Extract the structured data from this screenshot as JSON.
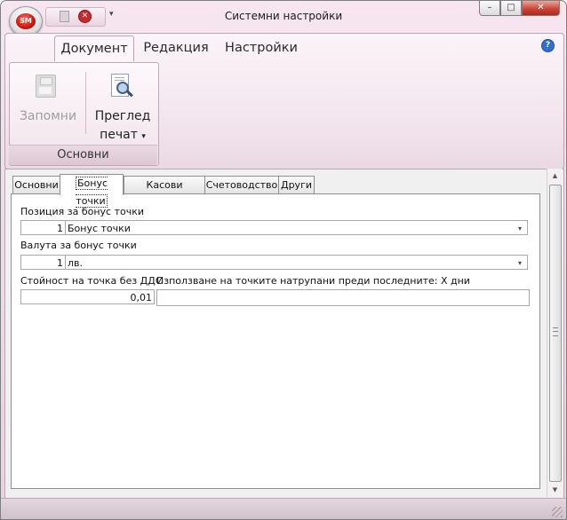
{
  "window": {
    "title": "Системни настройки",
    "controls": {
      "minimize": "–",
      "maximize": "□",
      "close": "✕"
    }
  },
  "app_orb": {
    "text": "SM"
  },
  "quick_access": {
    "close_glyph": "✕",
    "dropdown_glyph": "▾"
  },
  "ribbon": {
    "tabs": [
      {
        "label": "Документ",
        "active": true
      },
      {
        "label": "Редакция",
        "active": false
      },
      {
        "label": "Настройки",
        "active": false
      }
    ],
    "help_glyph": "?",
    "group": {
      "label": "Основни",
      "buttons": {
        "save": {
          "label": "Запомни",
          "enabled": false
        },
        "print_preview": {
          "line1": "Преглед",
          "line2": "печат",
          "arrow": "▾"
        }
      }
    }
  },
  "page_tabs": [
    {
      "label": "Основни",
      "active": false
    },
    {
      "label": "Бонус точки",
      "active": true
    },
    {
      "label": "Касови апарати",
      "active": false
    },
    {
      "label": "Счетоводство",
      "active": false
    },
    {
      "label": "Други",
      "active": false
    }
  ],
  "form": {
    "bonus_position": {
      "label": "Позиция за бонус точки",
      "code": "1",
      "value": "Бонус точки"
    },
    "bonus_currency": {
      "label": "Валута за бонус точки",
      "code": "1",
      "value": "лв."
    },
    "point_value": {
      "label": "Стойност на точка без ДДС",
      "value": "0,01"
    },
    "points_days": {
      "label": "Използване на точките натрупани преди последните: X дни",
      "value": ""
    },
    "dropdown_glyph": "▾"
  },
  "scrollbar": {
    "up_glyph": "▲",
    "down_glyph": "▼"
  },
  "colors": {
    "chrome": "#f1dbe7",
    "close_button": "#c8483a",
    "help": "#2f6fd0"
  }
}
